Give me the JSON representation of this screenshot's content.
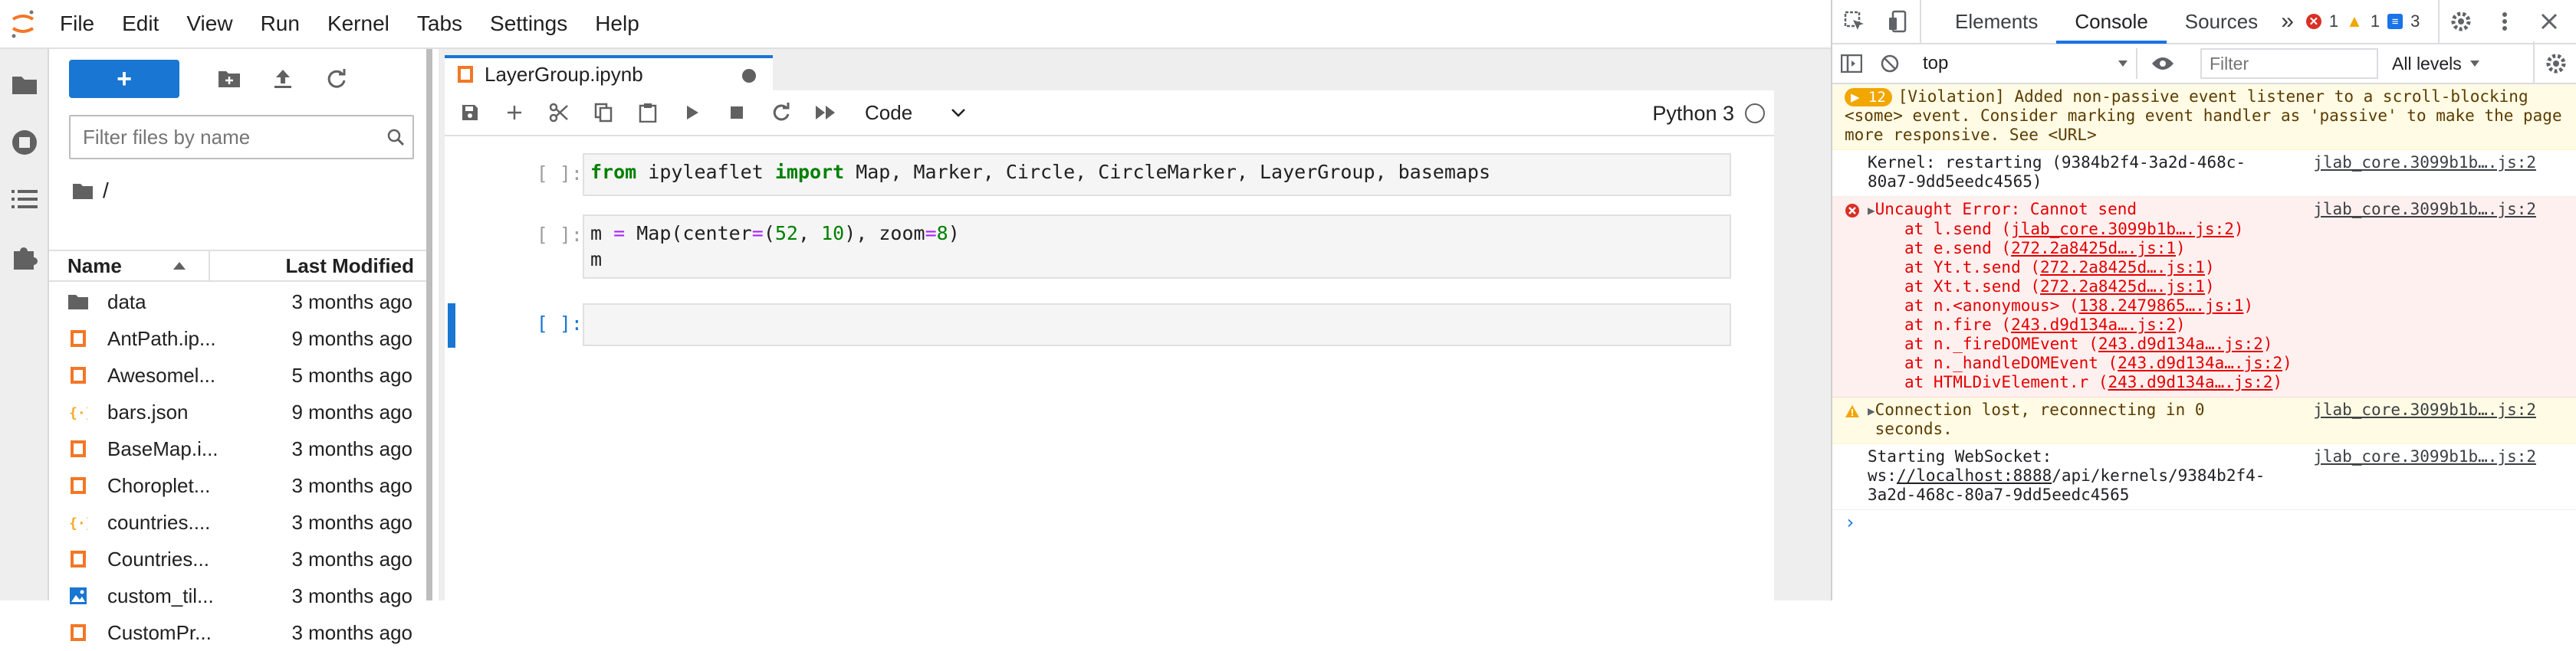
{
  "menubar": {
    "items": [
      "File",
      "Edit",
      "View",
      "Run",
      "Kernel",
      "Tabs",
      "Settings",
      "Help"
    ]
  },
  "filebrowser": {
    "new_label": "+",
    "filter_placeholder": "Filter files by name",
    "breadcrumb": "/",
    "col_name": "Name",
    "col_modified": "Last Modified",
    "files": [
      {
        "name": "data",
        "modified": "3 months ago",
        "icon": "folder-icon"
      },
      {
        "name": "AntPath.ip...",
        "modified": "9 months ago",
        "icon": "notebook-icon"
      },
      {
        "name": "Awesomel...",
        "modified": "5 months ago",
        "icon": "notebook-icon"
      },
      {
        "name": "bars.json",
        "modified": "9 months ago",
        "icon": "json-icon"
      },
      {
        "name": "BaseMap.i...",
        "modified": "3 months ago",
        "icon": "notebook-icon"
      },
      {
        "name": "Choroplet...",
        "modified": "3 months ago",
        "icon": "notebook-icon"
      },
      {
        "name": "countries....",
        "modified": "3 months ago",
        "icon": "json-icon"
      },
      {
        "name": "Countries...",
        "modified": "3 months ago",
        "icon": "notebook-icon"
      },
      {
        "name": "custom_til...",
        "modified": "3 months ago",
        "icon": "image-icon"
      },
      {
        "name": "CustomPr...",
        "modified": "3 months ago",
        "icon": "notebook-icon"
      }
    ]
  },
  "notebook": {
    "tab_title": "LayerGroup.ipynb",
    "cell_type": "Code",
    "kernel_name": "Python 3",
    "cells": [
      {
        "prompt": "[ ]:"
      },
      {
        "prompt": "[ ]:"
      },
      {
        "prompt": "[ ]:"
      }
    ],
    "code": {
      "c1_kw1": "from",
      "c1_mod": " ipyleaflet ",
      "c1_kw2": "import",
      "c1_rest": " Map, Marker, Circle, CircleMarker, LayerGroup, basemaps",
      "c2_a": "m ",
      "c2_eq": "=",
      "c2_b": " Map(center",
      "c2_eq2": "=",
      "c2_c": "(",
      "c2_n1": "52",
      "c2_d": ", ",
      "c2_n2": "10",
      "c2_e": "), zoom",
      "c2_eq3": "=",
      "c2_n3": "8",
      "c2_f": ")",
      "c2_line2": "m"
    }
  },
  "devtools": {
    "tabs": [
      "Elements",
      "Console",
      "Sources"
    ],
    "more": "»",
    "errors": "1",
    "warnings": "1",
    "infos": "3",
    "context": "top",
    "filter_placeholder": "Filter",
    "levels": "All levels",
    "messages": {
      "violation_count": "12",
      "violation_text": "[Violation] Added non-passive event listener to a scroll-blocking <some> event. Consider marking event handler as 'passive' to make the page more responsive. See <URL>",
      "kernel_text": "Kernel: restarting (9384b2f4-3a2d-468c-80a7-9dd5eedc4565)",
      "kernel_src": "jlab_core.3099b1b….js:2",
      "error_text": "Uncaught Error: Cannot send",
      "error_src": "jlab_core.3099b1b….js:2",
      "stack": [
        {
          "fn": "at l.send (",
          "loc": "jlab_core.3099b1b….js:2",
          "end": ")"
        },
        {
          "fn": "at e.send (",
          "loc": "272.2a8425d….js:1",
          "end": ")"
        },
        {
          "fn": "at Yt.t.send (",
          "loc": "272.2a8425d….js:1",
          "end": ")"
        },
        {
          "fn": "at Xt.t.send (",
          "loc": "272.2a8425d….js:1",
          "end": ")"
        },
        {
          "fn": "at n.<anonymous> (",
          "loc": "138.2479865….js:1",
          "end": ")"
        },
        {
          "fn": "at n.fire (",
          "loc": "243.d9d134a….js:2",
          "end": ")"
        },
        {
          "fn": "at n._fireDOMEvent (",
          "loc": "243.d9d134a….js:2",
          "end": ")"
        },
        {
          "fn": "at n._handleDOMEvent (",
          "loc": "243.d9d134a….js:2",
          "end": ")"
        },
        {
          "fn": "at HTMLDivElement.r (",
          "loc": "243.d9d134a….js:2",
          "end": ")"
        }
      ],
      "conn_text": "Connection lost, reconnecting in 0 seconds.",
      "conn_src": "jlab_core.3099b1b….js:2",
      "ws_text_a": "Starting WebSocket: ws:",
      "ws_link_a": "//localhost:888",
      "ws_link_b": "8",
      "ws_text_b": "/api/kernels/9384b2f4-3a2d-468c-80a7-9dd5eedc4565",
      "ws_src": "jlab_core.3099b1b….js:2",
      "prompt": "›"
    }
  },
  "colors": {
    "accent": "#1976d2",
    "error": "#e50000",
    "warning": "#f2a600"
  }
}
